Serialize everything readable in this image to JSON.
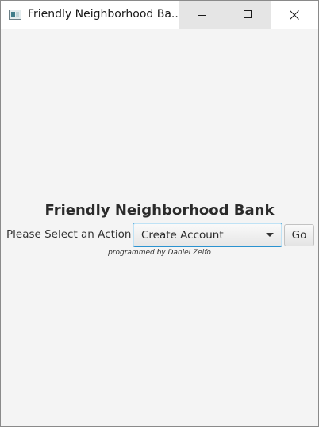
{
  "window": {
    "title": "Friendly Neighborhood Ba...",
    "icon": "java-app-icon",
    "controls": {
      "minimize": "minimize-icon",
      "maximize": "maximize-icon",
      "close": "close-icon"
    }
  },
  "main": {
    "heading": "Friendly Neighborhood Bank",
    "action_label": "Please Select an Action:",
    "action_select": {
      "selected": "Create Account"
    },
    "go_label": "Go",
    "credit": "programmed by Daniel Zelfo"
  },
  "colors": {
    "background": "#f4f4f4",
    "focus_border": "#2a92d0",
    "text": "#2b2b2b"
  }
}
